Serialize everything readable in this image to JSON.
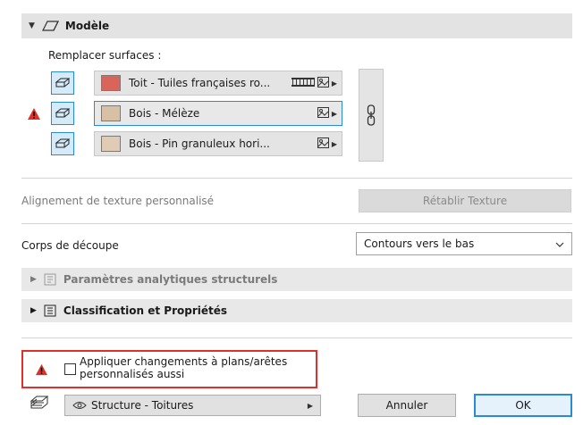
{
  "section": {
    "title": "Modèle",
    "icon": "model-shape-icon"
  },
  "surfaces": {
    "label": "Remplacer surfaces :",
    "items": [
      {
        "name": "Toit - Tuiles françaises ro...",
        "color": "#d9655a",
        "icon": "surface-top-icon",
        "pattern_icon": "tile-pattern-icon"
      },
      {
        "name": "Bois - Mélèze",
        "color": "#d8c0a4",
        "icon": "surface-side-icon",
        "warning": true
      },
      {
        "name": "Bois - Pin granuleux hori...",
        "color": "#e0ccb4",
        "icon": "surface-bottom-icon"
      }
    ]
  },
  "texture": {
    "label": "Alignement de texture personnalisé",
    "reset_button": "Rétablir Texture"
  },
  "cut_body": {
    "label": "Corps de découpe",
    "value": "Contours vers le bas"
  },
  "analytic": {
    "label": "Paramètres analytiques structurels"
  },
  "classification": {
    "label": "Classification et Propriétés"
  },
  "apply_checkbox": {
    "label_line1": "Appliquer changements à plans/arêtes",
    "label_line2": "personnalisés aussi",
    "checked": false
  },
  "footer": {
    "layer": "Structure - Toitures",
    "cancel": "Annuler",
    "ok": "OK"
  },
  "colors": {
    "accent": "#2a8ad4",
    "warning": "#e0302a",
    "highlight_border": "#e0302a"
  }
}
